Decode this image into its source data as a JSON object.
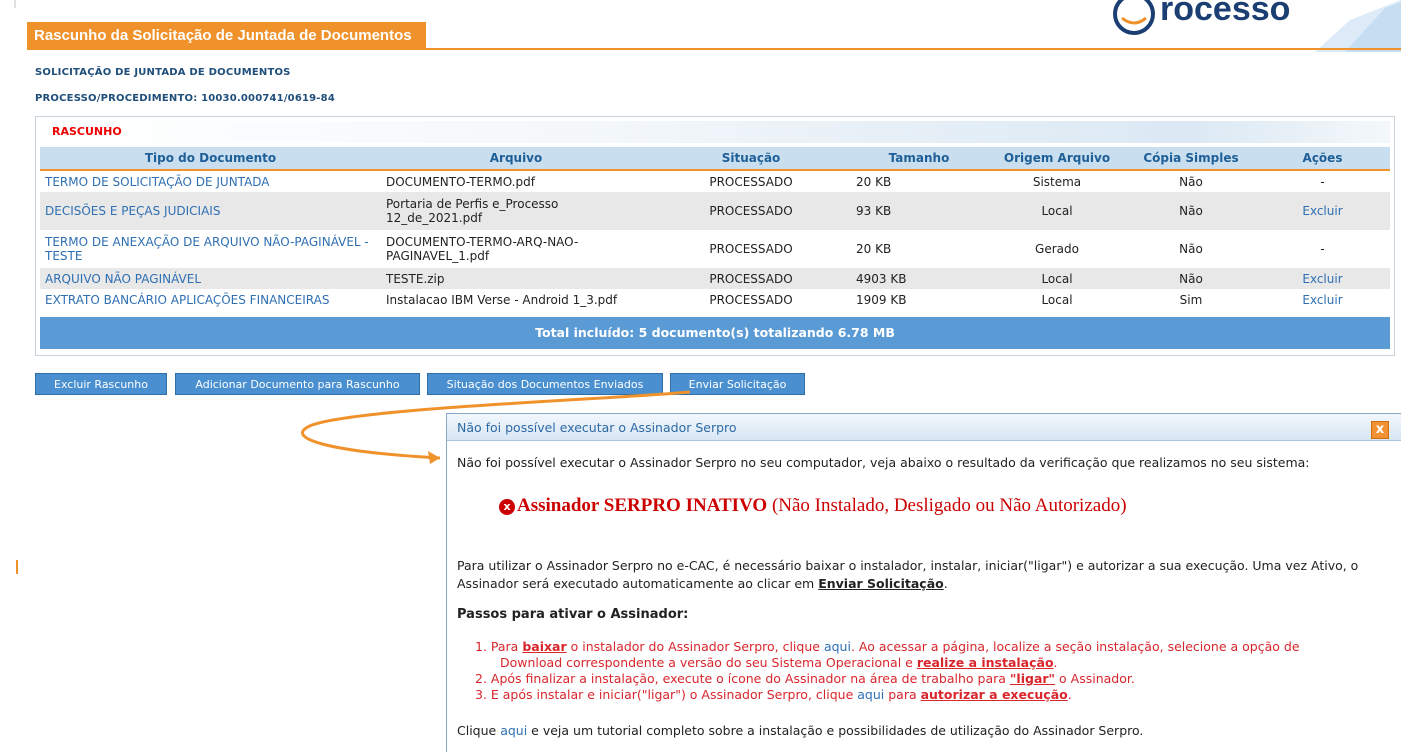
{
  "page": {
    "title": "Rascunho da Solicitação de Juntada de Documentos",
    "subtitle": "SOLICITAÇÃO DE JUNTADA DE DOCUMENTOS",
    "processo": "PROCESSO/PROCEDIMENTO: 10030.000741/0619-84",
    "logo_text": "rocesso"
  },
  "table": {
    "section_label": "RASCUNHO",
    "headers": [
      "Tipo do Documento",
      "Arquivo",
      "Situação",
      "Tamanho",
      "Origem Arquivo",
      "Cópia Simples",
      "Ações"
    ],
    "rows": [
      {
        "tipo": "TERMO DE SOLICITAÇÃO DE JUNTADA",
        "arquivo": "DOCUMENTO-TERMO.pdf",
        "situacao": "PROCESSADO",
        "tamanho": "20 KB",
        "origem": "Sistema",
        "copia": "Não",
        "acoes": "-"
      },
      {
        "tipo": "DECISÕES E PEÇAS JUDICIAIS",
        "arquivo1": "Portaria de Perfis e_Processo",
        "arquivo2": "12_de_2021.pdf",
        "situacao": "PROCESSADO",
        "tamanho": "93 KB",
        "origem": "Local",
        "copia": "Não",
        "acoes": "Excluir"
      },
      {
        "tipo1": "TERMO DE ANEXAÇÃO DE ARQUIVO NÃO-PAGINÁVEL -",
        "tipo2": "TESTE",
        "arquivo1": "DOCUMENTO-TERMO-ARQ-NAO-",
        "arquivo2": "PAGINAVEL_1.pdf",
        "situacao": "PROCESSADO",
        "tamanho": "20 KB",
        "origem": "Gerado",
        "copia": "Não",
        "acoes": "-"
      },
      {
        "tipo": "ARQUIVO NÃO PAGINÁVEL",
        "arquivo": "TESTE.zip",
        "situacao": "PROCESSADO",
        "tamanho": "4903 KB",
        "origem": "Local",
        "copia": "Não",
        "acoes": "Excluir"
      },
      {
        "tipo": "EXTRATO BANCÁRIO APLICAÇÕES FINANCEIRAS",
        "arquivo": "Instalacao IBM Verse - Android 1_3.pdf",
        "situacao": "PROCESSADO",
        "tamanho": "1909 KB",
        "origem": "Local",
        "copia": "Sim",
        "acoes": "Excluir"
      }
    ],
    "total": "Total incluído: 5 documento(s) totalizando 6.78 MB"
  },
  "buttons": {
    "excluir": "Excluir Rascunho",
    "adicionar": "Adicionar Documento para Rascunho",
    "situacao": "Situação dos Documentos Enviados",
    "enviar": "Enviar Solicitação"
  },
  "dialog": {
    "title": "Não foi possível executar o Assinador Serpro",
    "close": "x",
    "intro": "Não foi possível executar o Assinador Serpro no seu computador, veja abaixo o resultado da verificação que realizamos no seu sistema:",
    "status_icon": "x",
    "status_bold": "Assinador SERPRO INATIVO",
    "status_rest": " (Não Instalado, Desligado ou Não Autorizado)",
    "para_1a": "Para utilizar o Assinador Serpro no e-CAC, é necessário baixar o instalador, instalar, iniciar(\"ligar\") e autorizar a sua execução. Uma vez Ativo, o",
    "para_1b": "Assinador será executado automaticamente ao clicar em ",
    "para_1b_link": "Enviar Solicitação",
    "para_1b_end": ".",
    "steps_title": "Passos para ativar o Assinador:",
    "step1_a": "1. Para ",
    "step1_b": "baixar",
    "step1_c": " o instalador do Assinador Serpro, clique ",
    "step1_link": "aqui",
    "step1_d": ". Ao acessar a página, localize a seção instalação, selecione a opção de",
    "step1_e": "Download correspondente a versão do seu Sistema Operacional e ",
    "step1_f": "realize a instalação",
    "step1_g": ".",
    "step2_a": "2. Após finalizar a instalação, execute o ícone do Assinador na área de trabalho para ",
    "step2_b": "\"ligar\"",
    "step2_c": " o Assinador.",
    "step3_a": "3. E após instalar e iniciar(\"ligar\") o Assinador Serpro, clique ",
    "step3_link": "aqui",
    "step3_b": " para ",
    "step3_c": "autorizar a execução",
    "step3_d": ".",
    "footer_a": "Clique ",
    "footer_link": "aqui",
    "footer_b": " e veja um tutorial completo sobre a instalação e possibilidades de utilização do Assinador Serpro."
  },
  "colors": {
    "accent_orange": "#f0922b",
    "header_blue": "#c9dff0",
    "button_blue": "#4a8fd0",
    "total_bar": "#5b9bd5",
    "error_red": "#cc0000"
  }
}
